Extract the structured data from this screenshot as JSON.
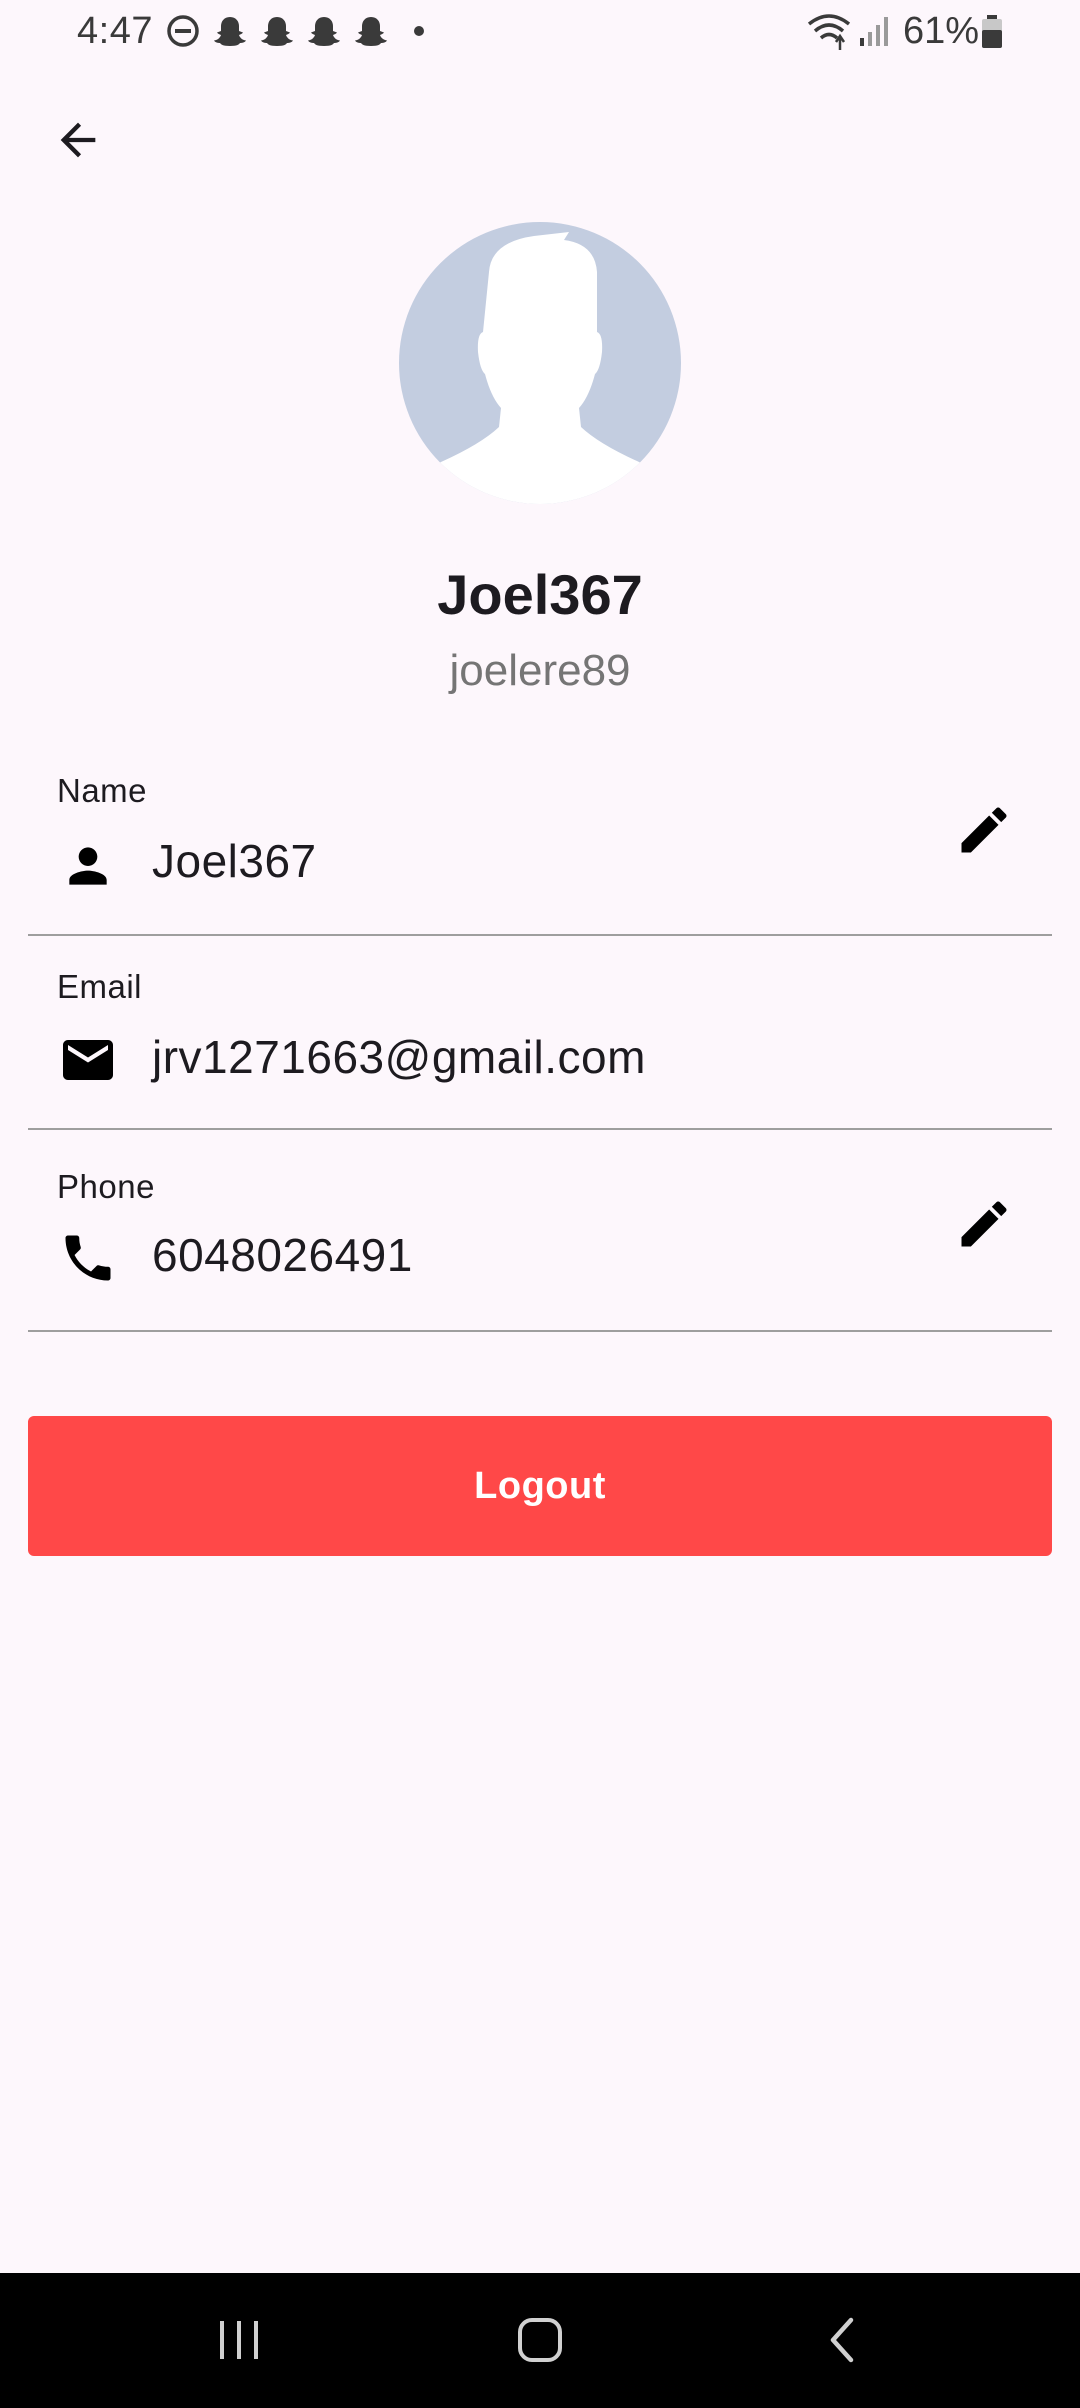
{
  "status_bar": {
    "time": "4:47",
    "battery": "61%",
    "icons": [
      "do-not-disturb-icon",
      "snapchat-icon",
      "snapchat-icon",
      "snapchat-icon",
      "snapchat-icon",
      "dot-icon",
      "wifi-icon",
      "signal-icon",
      "battery-icon"
    ]
  },
  "header": {
    "back_icon": "arrow-back-icon"
  },
  "profile": {
    "avatar_icon": "default-avatar",
    "display_name": "Joel367",
    "username": "joelere89"
  },
  "fields": [
    {
      "label": "Name",
      "value": "Joel367",
      "icon": "person-icon",
      "editable": true
    },
    {
      "label": "Email",
      "value": "jrv1271663@gmail.com",
      "icon": "mail-icon",
      "editable": false
    },
    {
      "label": "Phone",
      "value": "6048026491",
      "icon": "phone-icon",
      "editable": true
    }
  ],
  "actions": {
    "logout_label": "Logout"
  },
  "colors": {
    "background": "#fdf7fc",
    "logout": "#ff4848",
    "avatar_bg": "#c3cde0",
    "divider": "#9e9e9e"
  },
  "nav_bar": {
    "icons": [
      "recent-apps-icon",
      "home-icon",
      "back-icon"
    ]
  }
}
